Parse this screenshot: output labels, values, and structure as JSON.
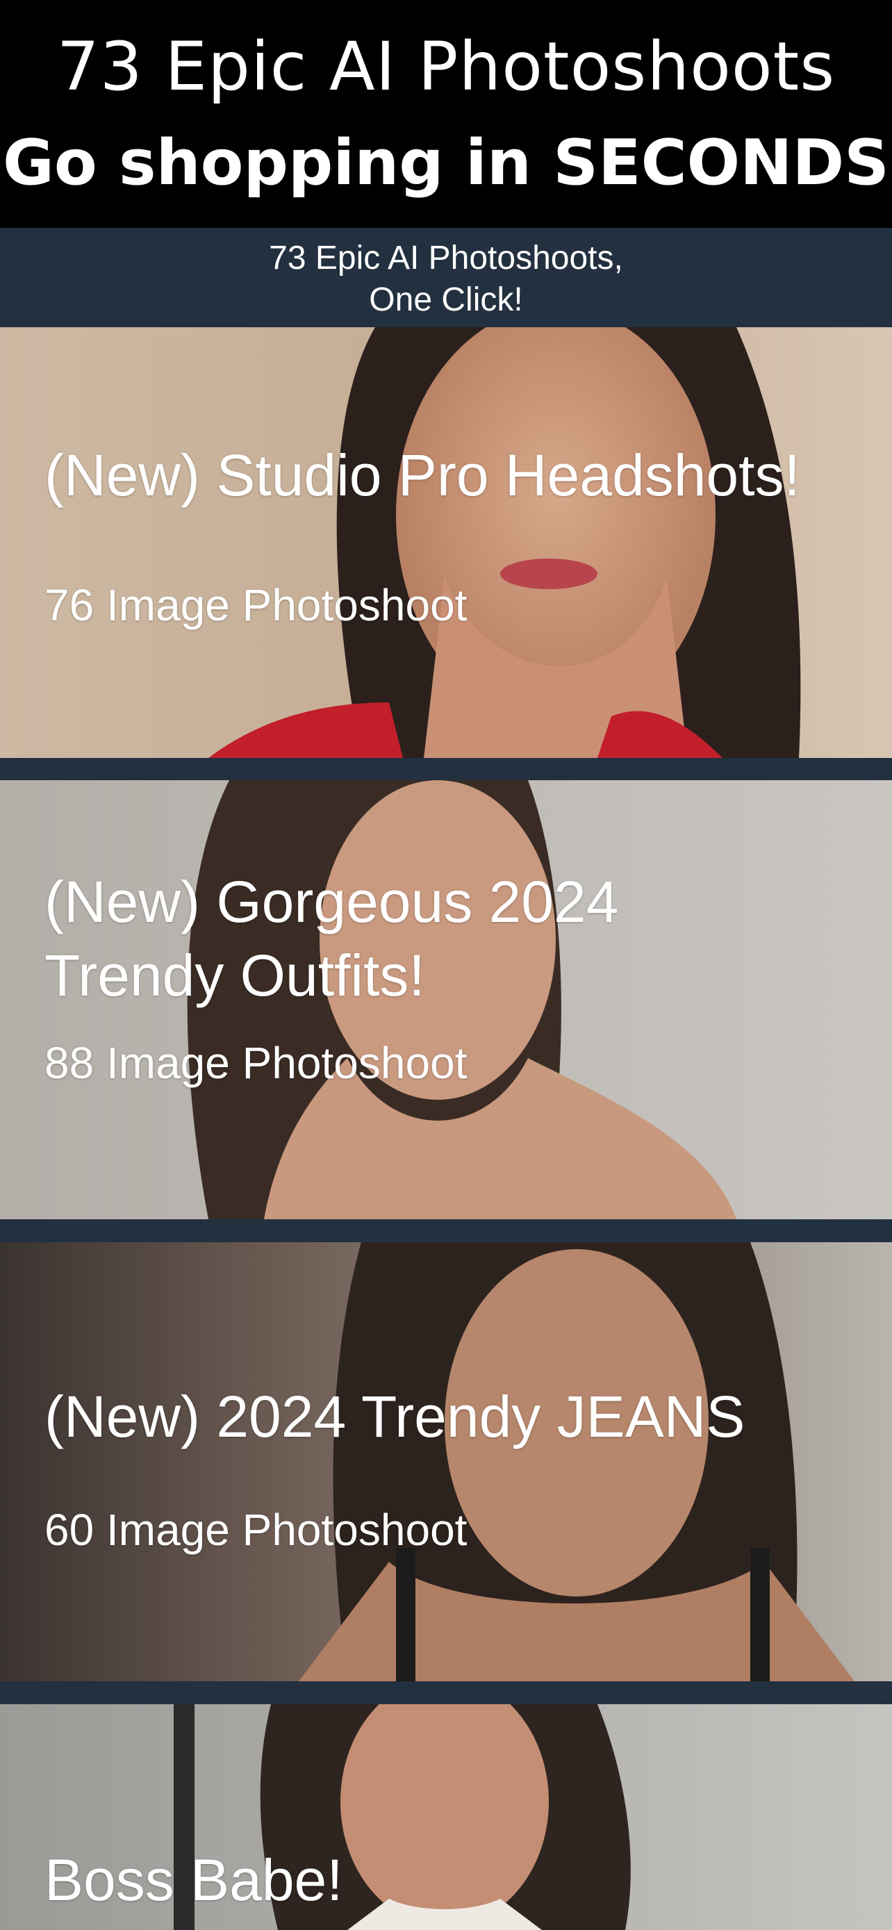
{
  "promo": {
    "line1": "73 Epic AI Photoshoots",
    "line2": "Go shopping in SECONDS"
  },
  "subheader": {
    "line1": "73 Epic AI Photoshoots,",
    "line2": "One Click!"
  },
  "cards": [
    {
      "title": "(New) Studio Pro Headshots!",
      "subtitle": "76 Image Photoshoot"
    },
    {
      "title": "(New) Gorgeous 2024 Trendy Outfits!",
      "subtitle": "88 Image Photoshoot"
    },
    {
      "title": "(New) 2024 Trendy JEANS",
      "subtitle": "60 Image Photoshoot"
    },
    {
      "title": "Boss Babe!"
    }
  ],
  "colors": {
    "background": "#22303f",
    "banner": "#000000",
    "text": "#ffffff"
  }
}
